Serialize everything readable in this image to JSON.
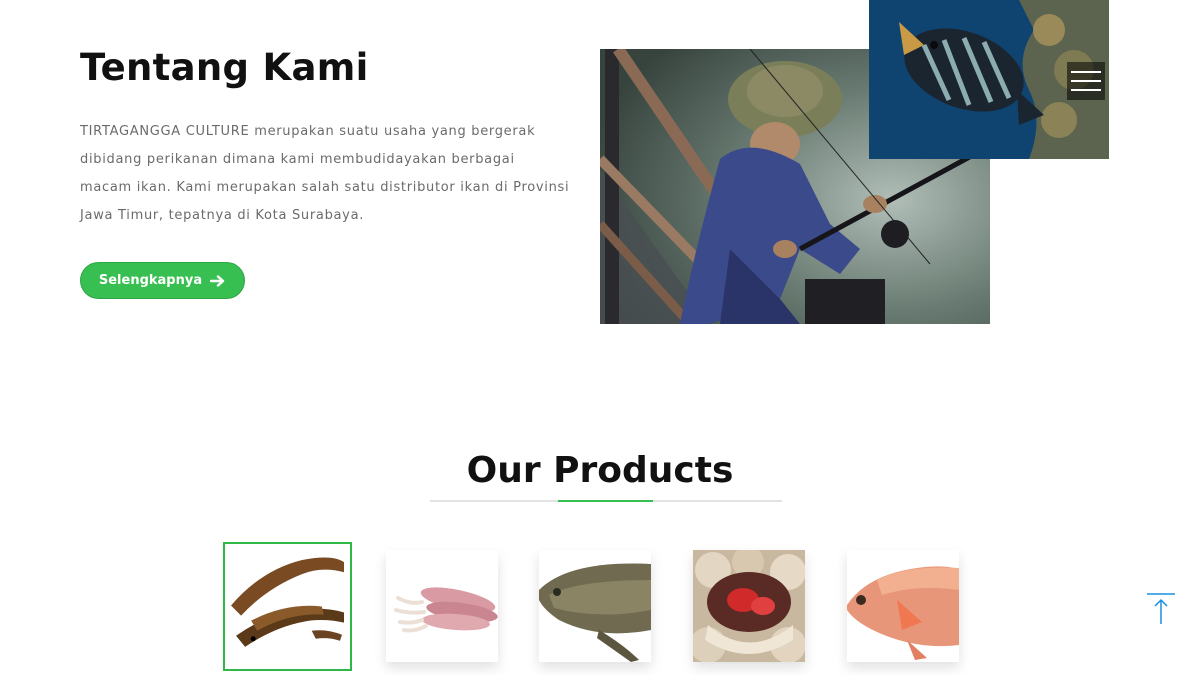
{
  "about": {
    "title": "Tentang Kami",
    "description": "TIRTAGANGGA CULTURE merupakan suatu usaha yang bergerak dibidang perikanan dimana kami membudidayakan berbagai macam ikan. Kami merupakan salah satu distributor ikan di Provinsi Jawa Timur, tepatnya di Kota Surabaya.",
    "button_label": "Selengkapnya",
    "button_icon": "arrow-right-icon"
  },
  "products": {
    "title": "Our Products",
    "accent_color": "#38bf52",
    "items": [
      {
        "icon": "eel-icon",
        "selected": true
      },
      {
        "icon": "squid-icon",
        "selected": false
      },
      {
        "icon": "gourami-fish-icon",
        "selected": false
      },
      {
        "icon": "cockle-shell-icon",
        "selected": false
      },
      {
        "icon": "red-tilapia-fish-icon",
        "selected": false
      }
    ]
  },
  "menu": {
    "icon": "hamburger-menu-icon"
  },
  "back_to_top": {
    "icon": "arrow-up-icon",
    "color": "#1a8fe0"
  }
}
